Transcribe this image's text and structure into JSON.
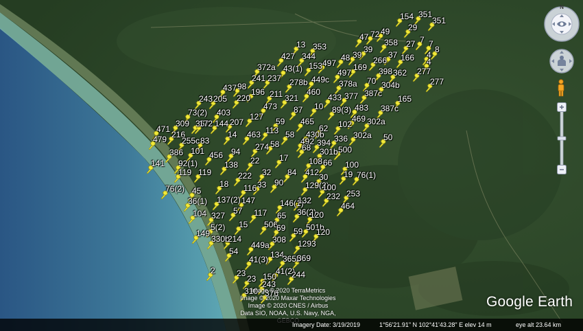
{
  "imagery": {
    "credits": [
      "Image © 2020 TerraMetrics",
      "Image © 2020 Maxar Technologies",
      "Image © 2020 CNES / Airbus",
      "Data SIO, NOAA, U.S. Navy, NGA, GEBCO"
    ],
    "logo": "Google Earth"
  },
  "status_bar": {
    "imagery_date": "Imagery Date: 3/19/2019",
    "coordinates": "1°56'21.91\" N  102°41'43.28\" E  elev   14 m",
    "eye_alt": "eye alt  23.64 km"
  },
  "navigation": {
    "compass_letter": "N",
    "icons": [
      "compass-ring-icon",
      "look-joystick-icon",
      "pegman-icon",
      "zoom-in-icon",
      "zoom-out-icon"
    ]
  },
  "colors": {
    "pin_yellow": "#f2ea3a",
    "pin_dark": "#8f8a10",
    "sea_deep": "#2c5a8a",
    "sea_shallow": "#5ea8b4",
    "forest": "#2d4a2a"
  },
  "pin_labels": [
    "154",
    "351",
    "351",
    "29",
    "47",
    "72",
    "49",
    "358",
    "27",
    "7",
    "7",
    "13",
    "39",
    "37",
    "4",
    "8",
    "353",
    "427",
    "344",
    "48",
    "39",
    "266",
    "166",
    "4",
    "153",
    "497",
    "169",
    "372a",
    "43(1)",
    "497",
    "398",
    "362",
    "277",
    "241",
    "237",
    "449c",
    "378a",
    "70",
    "304b",
    "277",
    "278b",
    "437",
    "98",
    "196",
    "211",
    "460",
    "433",
    "377",
    "387c",
    "165",
    "243",
    "205",
    "220",
    "321",
    "10",
    "89(3)",
    "483",
    "387c",
    "73(2)",
    "403",
    "473",
    "87",
    "469",
    "302a",
    "309",
    "367",
    "207",
    "127",
    "59",
    "465",
    "62",
    "102",
    "471",
    "172",
    "144",
    "336",
    "302a",
    "50",
    "216",
    "14",
    "463",
    "113",
    "58",
    "430b",
    "479",
    "255c",
    "83",
    "58",
    "492",
    "394",
    "500",
    "386",
    "101",
    "456",
    "94",
    "274",
    "68",
    "301b",
    "141",
    "92(1)",
    "138",
    "22",
    "17",
    "108",
    "66",
    "100",
    "119",
    "119",
    "222",
    "32",
    "84",
    "412",
    "30",
    "19",
    "76(1)",
    "76(2)",
    "45",
    "18",
    "116",
    "33",
    "90",
    "129(2)",
    "100",
    "253",
    "36(1)",
    "137(2)",
    "147",
    "146(1)",
    "132",
    "232",
    "464",
    "104",
    "327",
    "57",
    "117",
    "65",
    "36(2)",
    "120",
    "5(2)",
    "15",
    "506",
    "69",
    "59",
    "501b",
    "120",
    "149",
    "330b",
    "214",
    "308",
    "449a",
    "1293",
    "54",
    "134",
    "365b",
    "369",
    "41(3)",
    "2",
    "23",
    "41(2)",
    "244",
    "23",
    "150",
    "243",
    "310",
    "376"
  ]
}
